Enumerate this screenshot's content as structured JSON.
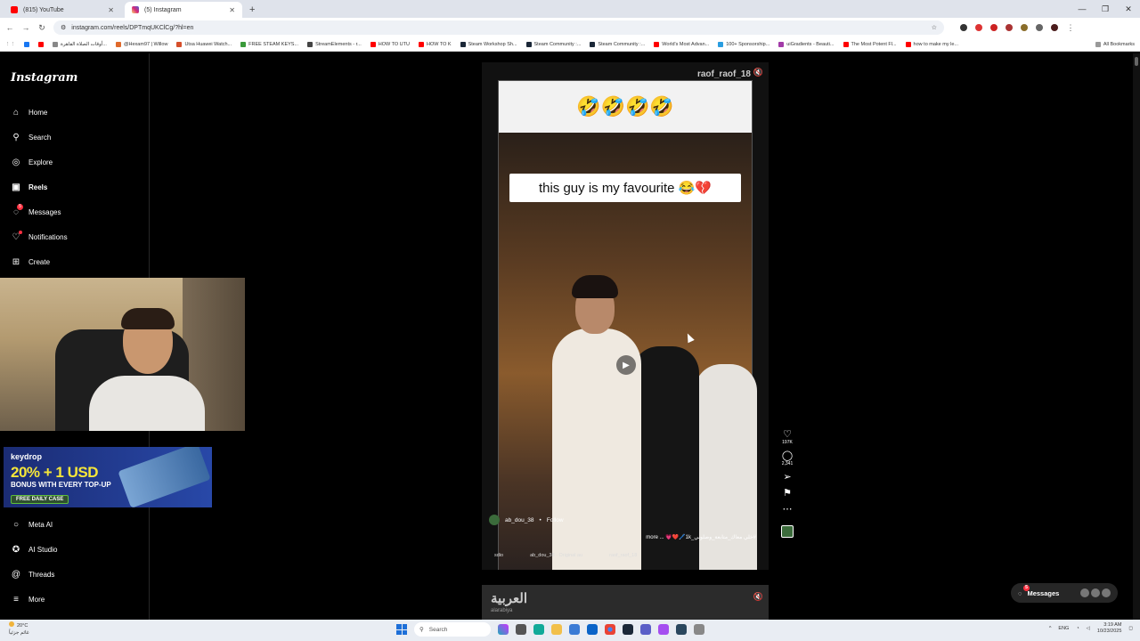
{
  "browser": {
    "tabs": [
      {
        "title": "(815) YouTube",
        "color": "#ff0000"
      },
      {
        "title": "(5) Instagram",
        "color": "#d6249f"
      }
    ],
    "url": "instagram.com/reels/DPTmqUKClCg/?hl=en",
    "bookmarks": [
      {
        "label": "",
        "color": "#1877f2"
      },
      {
        "label": "",
        "color": "#ff0000"
      },
      {
        "label": "أوقات الصلاة القاهرة...",
        "color": "#888888"
      },
      {
        "label": "@Hexam97 | Willow",
        "color": "#e06a2b"
      },
      {
        "label": "Utsa Huawei Watch...",
        "color": "#d64f2b"
      },
      {
        "label": "FREE STEAM KEYS...",
        "color": "#3a9a3a"
      },
      {
        "label": "StreamElements - r...",
        "color": "#444444"
      },
      {
        "label": "HOW TO UTU",
        "color": "#ff0000"
      },
      {
        "label": "HOW TO K",
        "color": "#ff0000"
      },
      {
        "label": "Steam Workshop Sh...",
        "color": "#1b2838"
      },
      {
        "label": "Steam Community :...",
        "color": "#1b2838"
      },
      {
        "label": "Steam Community :...",
        "color": "#1b2838"
      },
      {
        "label": "World's Most Advan...",
        "color": "#ff0000"
      },
      {
        "label": "100+ Sponsorship...",
        "color": "#2a9de0"
      },
      {
        "label": "uiGradients - Beauti...",
        "color": "#a23ba8"
      },
      {
        "label": "The Most Potent Fl...",
        "color": "#ff0000"
      },
      {
        "label": "how to make my le...",
        "color": "#ff0000"
      }
    ],
    "all_bookmarks": "All Bookmarks"
  },
  "sidebar": {
    "logo": "Instagram",
    "items": [
      {
        "label": "Home",
        "icon": "home-icon",
        "glyph": "⌂"
      },
      {
        "label": "Search",
        "icon": "search-icon",
        "glyph": "⚲"
      },
      {
        "label": "Explore",
        "icon": "compass-icon",
        "glyph": "◎"
      },
      {
        "label": "Reels",
        "icon": "reels-icon",
        "glyph": "▣"
      },
      {
        "label": "Messages",
        "icon": "messenger-icon",
        "glyph": "◌",
        "badge": "5"
      },
      {
        "label": "Notifications",
        "icon": "heart-icon",
        "glyph": "♡"
      },
      {
        "label": "Create",
        "icon": "plus-square-icon",
        "glyph": "⊞"
      }
    ],
    "bottom_items": [
      {
        "label": "Meta AI",
        "icon": "meta-ai-icon",
        "glyph": "○"
      },
      {
        "label": "AI Studio",
        "icon": "ai-studio-icon",
        "glyph": "✪"
      },
      {
        "label": "Threads",
        "icon": "threads-icon",
        "glyph": "@"
      },
      {
        "label": "More",
        "icon": "menu-icon",
        "glyph": "≡"
      }
    ]
  },
  "ad": {
    "brand": "keydrop",
    "headline": "20% + 1 USD",
    "subline": "BONUS WITH EVERY TOP-UP",
    "pill": "FREE DAILY CASE"
  },
  "reel": {
    "watermark": "raof_raof_18",
    "emojis": "🤣🤣🤣🤣",
    "caption": "this guy is my favourite 😂💔",
    "author": "ab_dou_38",
    "follow": "Follow",
    "description": "more ... 💗❤️🖊️1k_خلي معاك_متابعة_وصلوني#",
    "audio": "ab_dou_38 · Original au",
    "audio_label": "sdio",
    "tagged": "raof_raof_18",
    "likes": "197K",
    "comments": "2,341"
  },
  "next_reel": {
    "brand": "العربية",
    "sub": "alarabiya"
  },
  "messages_pill": {
    "label": "Messages",
    "badge": "5"
  },
  "taskbar": {
    "temp": "20°C",
    "weather": "غائم جزئياً",
    "search": "Search",
    "lang": "ENG",
    "time": "3:19 AM",
    "date": "10/23/2025"
  }
}
